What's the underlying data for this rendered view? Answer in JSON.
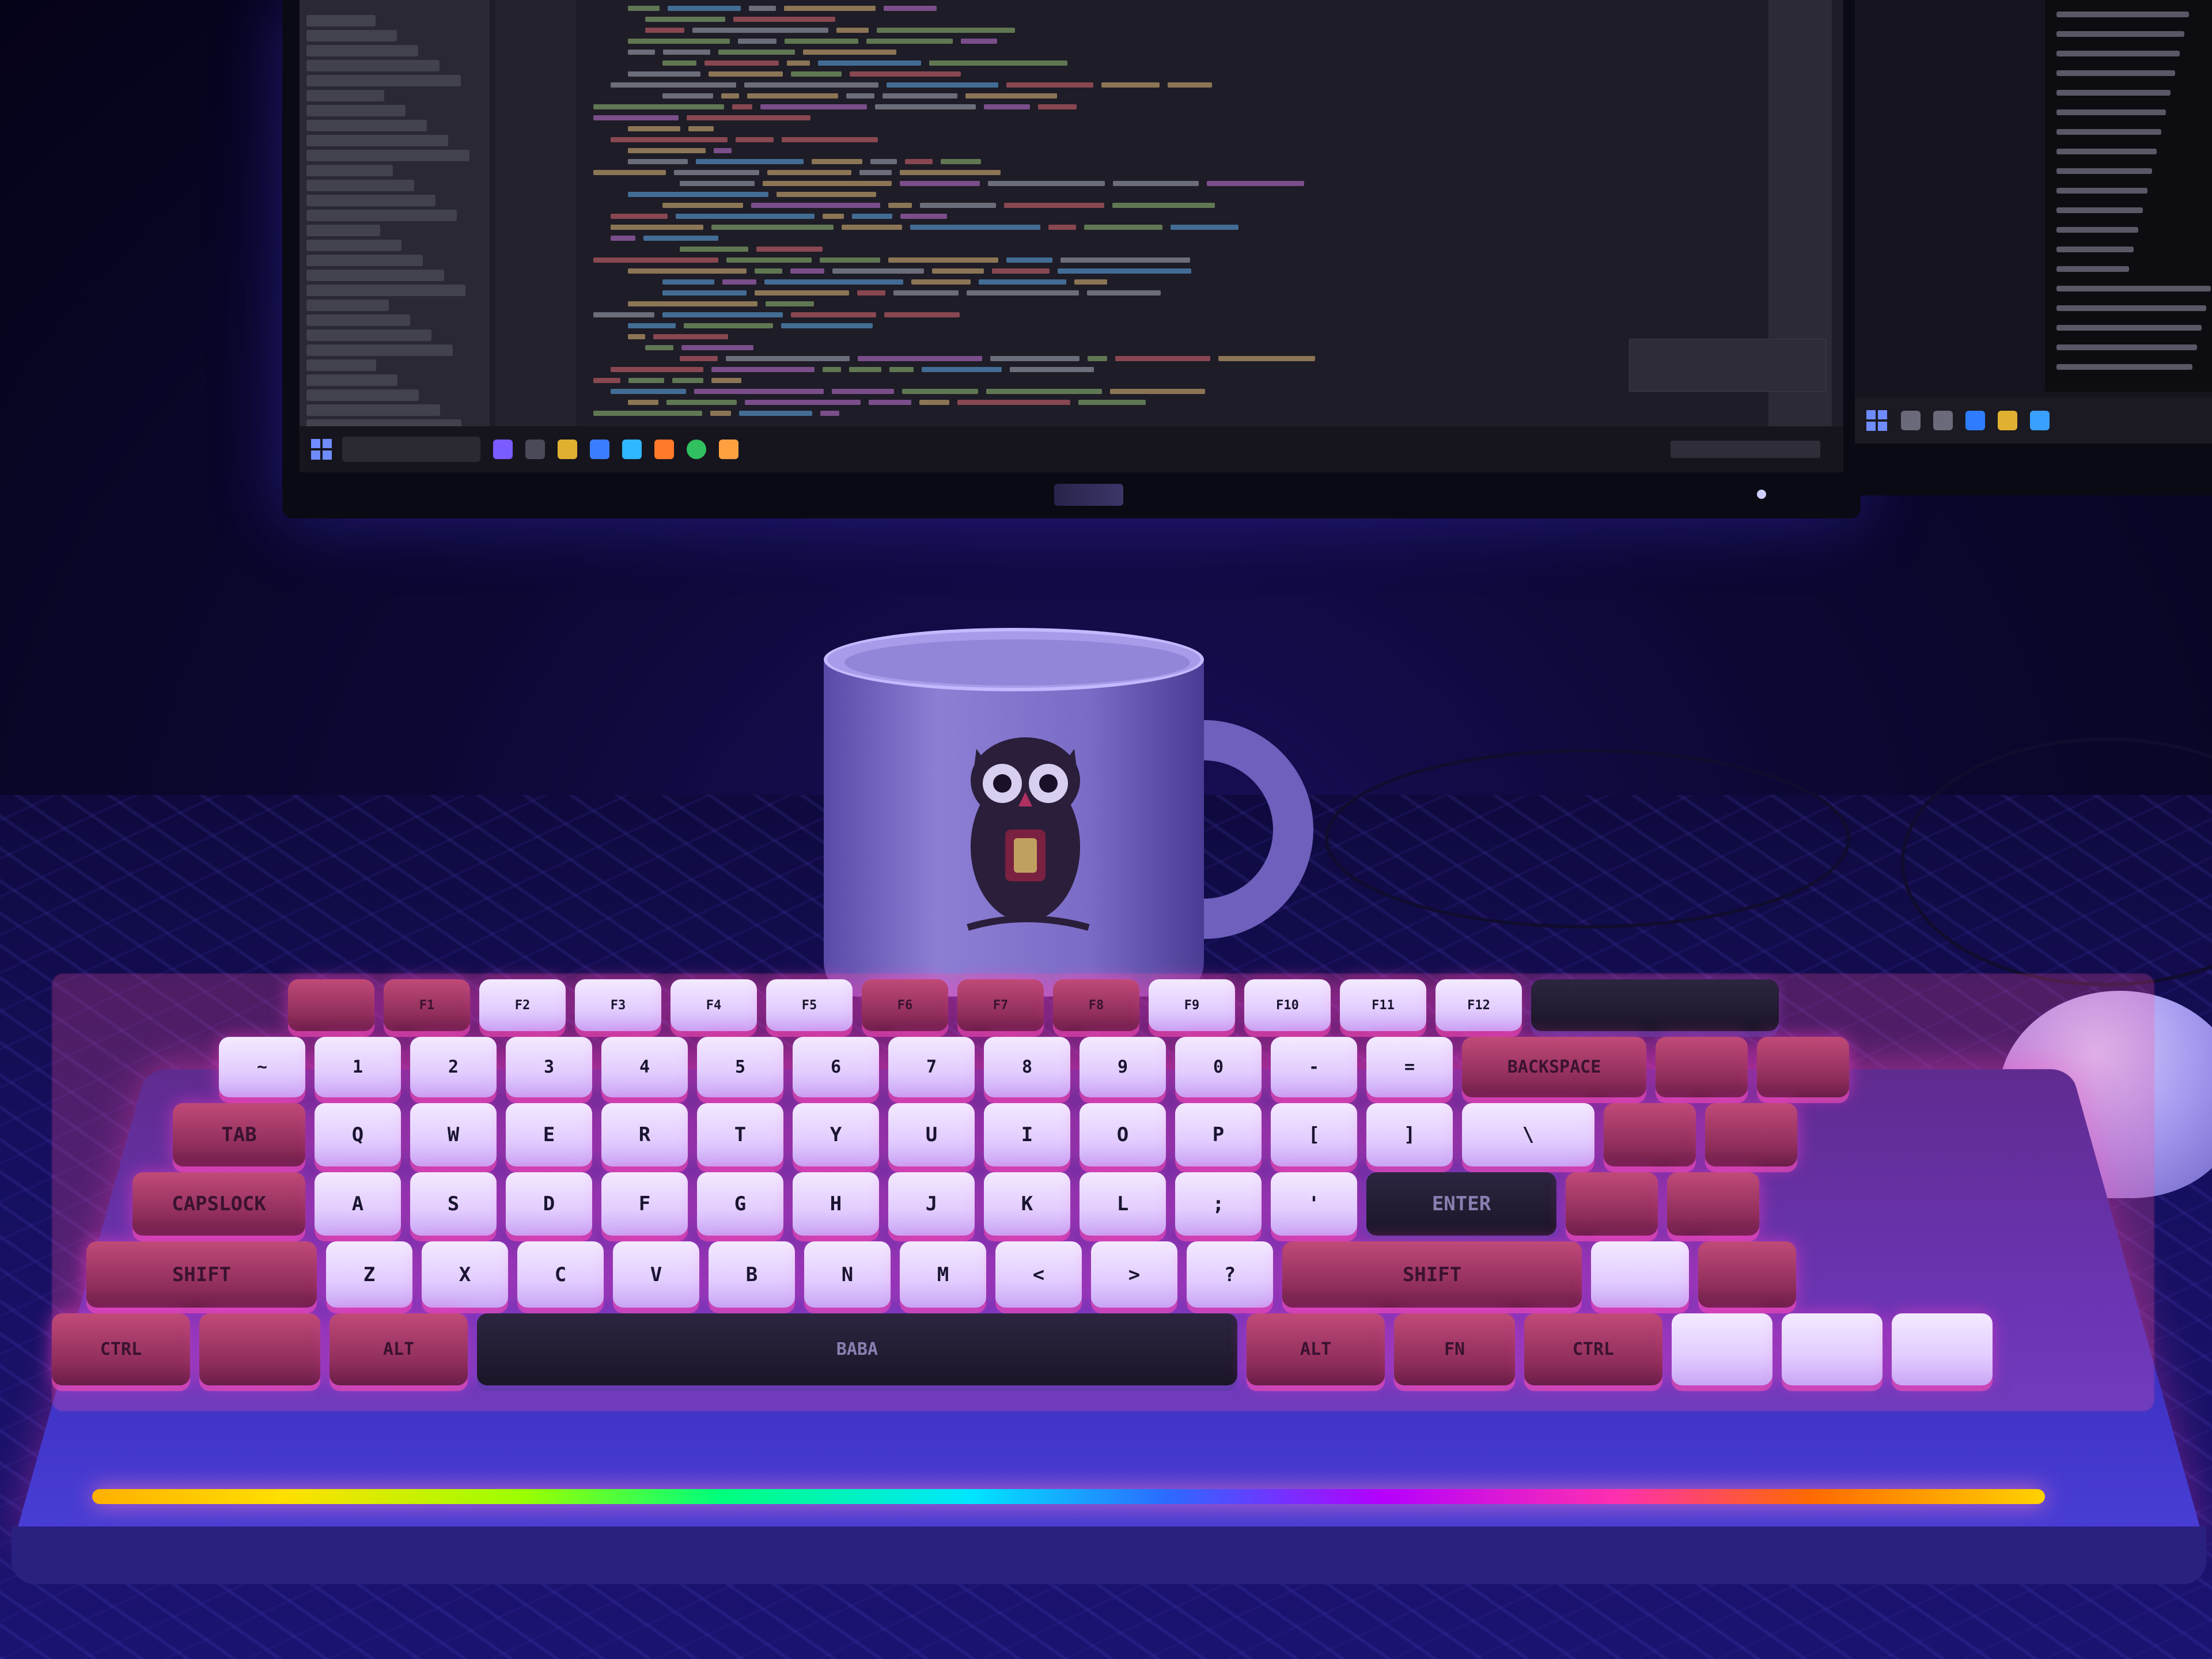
{
  "scene": {
    "description_colors": {
      "ambient": "#1a0f5c",
      "keycap_light": "#f3eaff",
      "keycap_accent": "#c04a78",
      "underglow": "#ff4fa0"
    }
  },
  "keyboard": {
    "fn_row": [
      "",
      "F1",
      "F2",
      "F3",
      "F4",
      "F5",
      "F6",
      "F7",
      "F8",
      "F9",
      "F10",
      "F11",
      "F12",
      ""
    ],
    "number_row": [
      "~",
      "1",
      "2",
      "3",
      "4",
      "5",
      "6",
      "7",
      "8",
      "9",
      "0",
      "-",
      "=",
      "BACKSPACE",
      "",
      ""
    ],
    "q_row": [
      "TAB",
      "Q",
      "W",
      "E",
      "R",
      "T",
      "Y",
      "U",
      "I",
      "O",
      "P",
      "[",
      "]",
      "\\",
      "",
      ""
    ],
    "a_row": [
      "CAPSLOCK",
      "A",
      "S",
      "D",
      "F",
      "G",
      "H",
      "J",
      "K",
      "L",
      ";",
      "'",
      "ENTER",
      "",
      ""
    ],
    "z_row": [
      "SHIFT",
      "Z",
      "X",
      "C",
      "V",
      "B",
      "N",
      "M",
      "<",
      ">",
      "?",
      "SHIFT",
      "",
      ""
    ],
    "bottom_row": [
      "CTRL",
      "",
      "ALT",
      "BABA",
      "ALT",
      "FN",
      "CTRL",
      "",
      "",
      ""
    ]
  }
}
